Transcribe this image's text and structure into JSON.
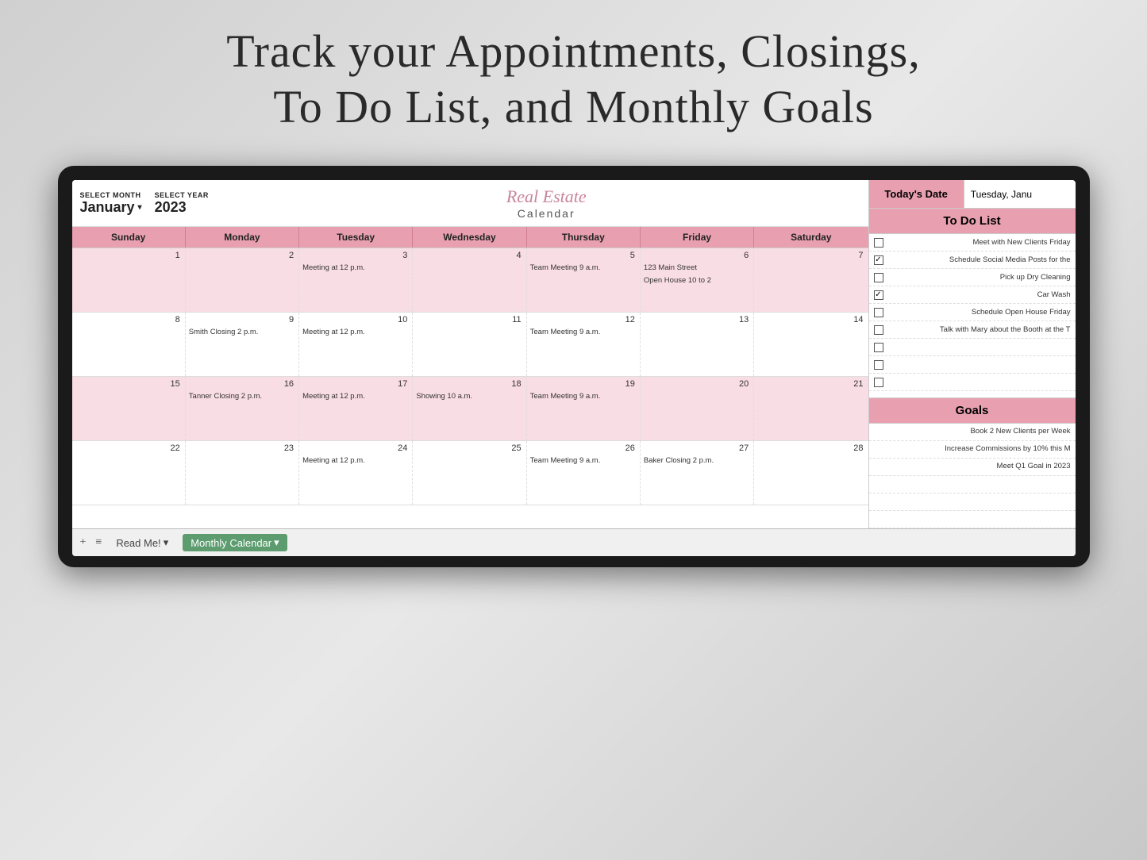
{
  "title": {
    "line1": "Track your Appointments, Closings,",
    "line2": "To Do List, and Monthly Goals"
  },
  "header": {
    "select_month_label": "SELECT MONTH",
    "select_year_label": "SELECT YEAR",
    "month_value": "January",
    "year_value": "2023",
    "cal_title_script": "Real Estate",
    "cal_title_plain": "Calendar"
  },
  "day_headers": [
    "Sunday",
    "Monday",
    "Tuesday",
    "Wednesday",
    "Thursday",
    "Friday",
    "Saturday"
  ],
  "weeks": [
    {
      "pink": true,
      "cells": [
        {
          "num": "1",
          "events": []
        },
        {
          "num": "2",
          "events": []
        },
        {
          "num": "3",
          "events": [
            "Meeting at 12 p.m."
          ]
        },
        {
          "num": "4",
          "events": []
        },
        {
          "num": "5",
          "events": [
            "Team Meeting 9 a.m."
          ]
        },
        {
          "num": "6",
          "events": [
            "123 Main Street",
            "Open House 10 to 2"
          ]
        },
        {
          "num": "7",
          "events": []
        }
      ]
    },
    {
      "pink": false,
      "cells": [
        {
          "num": "8",
          "events": []
        },
        {
          "num": "9",
          "events": [
            "Smith Closing 2 p.m."
          ]
        },
        {
          "num": "10",
          "events": [
            "Meeting at 12 p.m."
          ]
        },
        {
          "num": "11",
          "events": []
        },
        {
          "num": "12",
          "events": [
            "Team Meeting 9 a.m."
          ]
        },
        {
          "num": "13",
          "events": []
        },
        {
          "num": "14",
          "events": []
        }
      ]
    },
    {
      "pink": true,
      "cells": [
        {
          "num": "15",
          "events": []
        },
        {
          "num": "16",
          "events": [
            "Tanner Closing 2 p.m."
          ]
        },
        {
          "num": "17",
          "events": [
            "Meeting at 12 p.m."
          ]
        },
        {
          "num": "18",
          "events": [
            "Showing 10 a.m."
          ]
        },
        {
          "num": "19",
          "events": [
            "Team Meeting 9 a.m."
          ]
        },
        {
          "num": "20",
          "events": []
        },
        {
          "num": "21",
          "events": []
        }
      ]
    },
    {
      "pink": false,
      "cells": [
        {
          "num": "22",
          "events": []
        },
        {
          "num": "23",
          "events": []
        },
        {
          "num": "24",
          "events": [
            "Meeting at 12 p.m."
          ]
        },
        {
          "num": "25",
          "events": []
        },
        {
          "num": "26",
          "events": [
            "Team Meeting 9 a.m."
          ]
        },
        {
          "num": "27",
          "events": [
            "Baker Closing 2 p.m."
          ]
        },
        {
          "num": "28",
          "events": []
        }
      ]
    }
  ],
  "sidebar": {
    "today_label": "Today's Date",
    "today_date": "Tuesday, Janu",
    "todo_header": "To Do List",
    "todo_items": [
      {
        "text": "Meet with New Clients Friday",
        "checked": false
      },
      {
        "text": "Schedule Social Media Posts for the",
        "checked": true
      },
      {
        "text": "Pick up Dry Cleaning",
        "checked": false
      },
      {
        "text": "Car Wash",
        "checked": true
      },
      {
        "text": "Schedule Open House Friday",
        "checked": false
      },
      {
        "text": "Talk with Mary about the Booth at the T",
        "checked": false
      },
      {
        "text": "",
        "checked": false
      },
      {
        "text": "",
        "checked": false
      },
      {
        "text": "",
        "checked": false
      }
    ],
    "goals_header": "Goals",
    "goals": [
      "Book 2 New Clients per Week",
      "Increase Commissions by 10% this M",
      "Meet Q1 Goal in 2023",
      "",
      "",
      ""
    ]
  },
  "tabs": {
    "add_icon": "+",
    "menu_icon": "≡",
    "read_me": "Read Me!",
    "monthly_calendar": "Monthly Calendar"
  }
}
